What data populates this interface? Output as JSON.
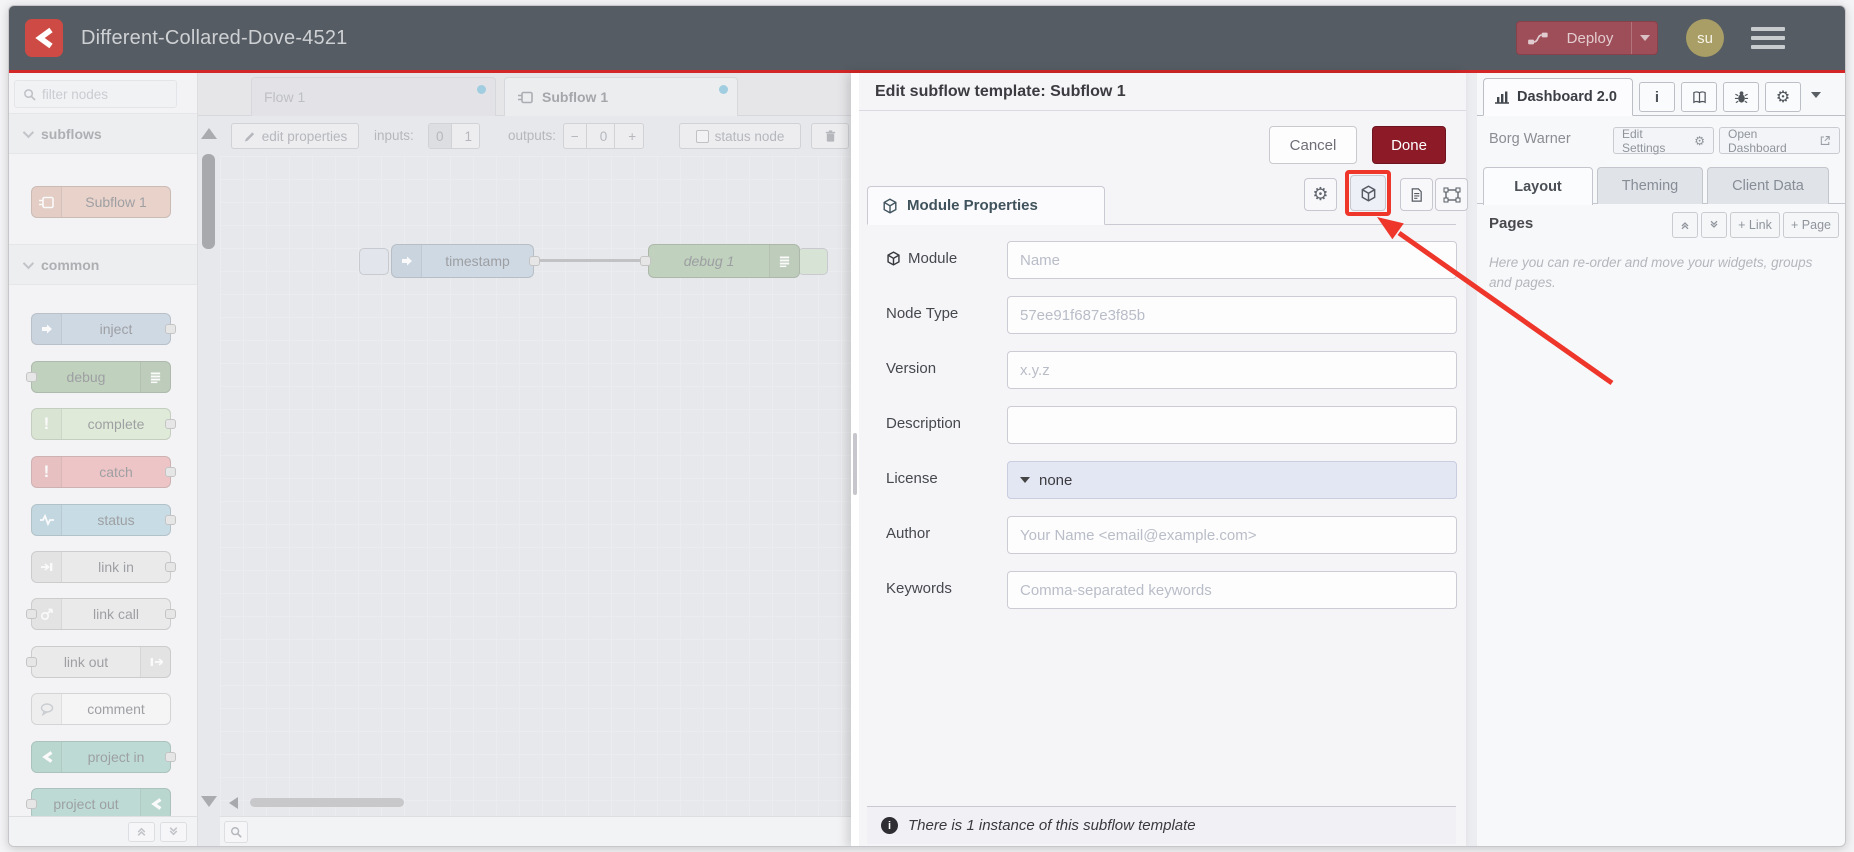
{
  "header": {
    "title": "Different-Collared-Dove-4521",
    "deploy_label": "Deploy",
    "avatar_initials": "su"
  },
  "palette": {
    "filter_placeholder": "filter nodes",
    "sections": [
      {
        "label": "subflows"
      },
      {
        "label": "common"
      }
    ],
    "nodes": [
      {
        "label": "Subflow 1"
      },
      {
        "label": "inject"
      },
      {
        "label": "debug"
      },
      {
        "label": "complete"
      },
      {
        "label": "catch"
      },
      {
        "label": "status"
      },
      {
        "label": "link in"
      },
      {
        "label": "link call"
      },
      {
        "label": "link out"
      },
      {
        "label": "comment"
      },
      {
        "label": "project in"
      },
      {
        "label": "project out"
      }
    ]
  },
  "workspace": {
    "tabs": [
      {
        "label": "Flow 1"
      },
      {
        "label": "Subflow 1"
      }
    ],
    "toolbar": {
      "edit_properties": "edit properties",
      "inputs_label": "inputs:",
      "input_options": [
        "0",
        "1"
      ],
      "outputs_label": "outputs:",
      "minus": "−",
      "outputs_value": "0",
      "plus": "+",
      "status_node": "status node"
    },
    "nodes": [
      {
        "label": "timestamp"
      },
      {
        "label": "debug 1"
      }
    ]
  },
  "tray": {
    "title": "Edit subflow template: Subflow 1",
    "cancel_label": "Cancel",
    "done_label": "Done",
    "tab_label": "Module Properties",
    "fields": [
      {
        "label": "Module",
        "placeholder": "Name"
      },
      {
        "label": "Node Type",
        "placeholder": "57ee91f687e3f85b"
      },
      {
        "label": "Version",
        "placeholder": "x.y.z"
      },
      {
        "label": "Description",
        "placeholder": ""
      },
      {
        "label": "License",
        "value": "none"
      },
      {
        "label": "Author",
        "placeholder": "Your Name <email@example.com>"
      },
      {
        "label": "Keywords",
        "placeholder": "Comma-separated keywords"
      }
    ],
    "footer_note": "There is 1 instance of this subflow template"
  },
  "sidebar": {
    "tab_label": "Dashboard 2.0",
    "instance_name": "Borg Warner",
    "edit_settings_label": "Edit Settings",
    "open_dashboard_label": "Open Dashboard",
    "tabs": [
      {
        "label": "Layout"
      },
      {
        "label": "Theming"
      },
      {
        "label": "Client Data"
      }
    ],
    "pages_title": "Pages",
    "link_button": "+ Link",
    "page_button": "+ Page",
    "help_text": "Here you can re-order and move your widgets, groups and pages."
  },
  "colors": {
    "accent_red": "#d32727",
    "annotation_red": "#ee362b",
    "header_bg": "#565c63",
    "logo_red": "#ce4b45",
    "deploy_bg": "#9e4e58",
    "done_bg": "#8c1a27",
    "avatar_bg": "#a89e66",
    "modified_dot": "#45a2c6",
    "node_subflow": "#dbab98",
    "node_inject": "#a6bbcf",
    "node_inject_button": "#ccd6df",
    "node_debug": "#87a980",
    "node_debug_button": "#b7cfae",
    "node_complete": "#c7dfb7",
    "node_catch": "#e49191",
    "node_status": "#94c1d0",
    "node_link": "#dddddd",
    "node_comment": "#f4f4f4",
    "node_project": "#7fbfae"
  }
}
